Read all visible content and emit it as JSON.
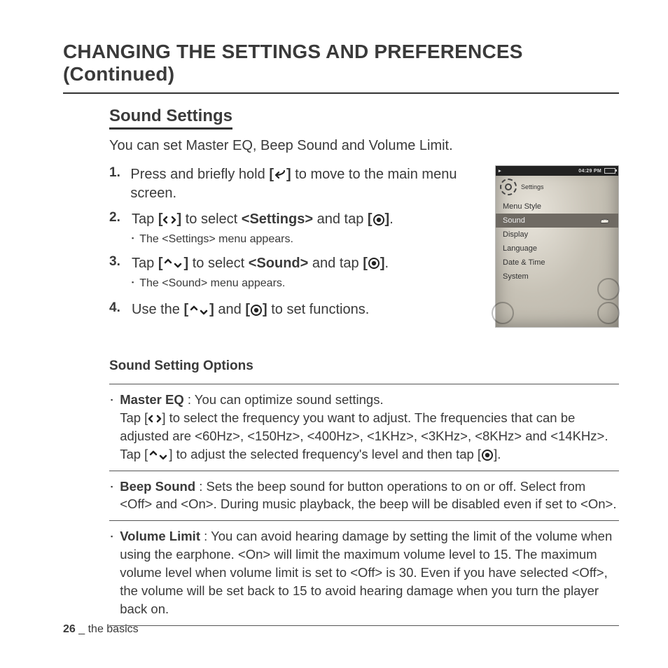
{
  "chapter_title": "CHANGING THE SETTINGS AND PREFERENCES (Continued)",
  "section_title": "Sound Settings",
  "intro": "You can set Master EQ, Beep Sound and Volume Limit.",
  "steps": [
    {
      "num": "1.",
      "pre": "Press and briefly hold ",
      "bracket_open": "[",
      "bracket_close": "]",
      "post": " to move to the main menu screen.",
      "sub": null
    },
    {
      "num": "2.",
      "pre": "Tap ",
      "mid1": " to select ",
      "bold1": "<Settings>",
      "mid2": " and tap ",
      "post": ".",
      "sub": "The <Settings> menu appears."
    },
    {
      "num": "3.",
      "pre": "Tap ",
      "mid1": " to select ",
      "bold1": "<Sound>",
      "mid2": " and tap ",
      "post": ".",
      "sub": "The <Sound> menu appears."
    },
    {
      "num": "4.",
      "pre": "Use the ",
      "mid2": " and ",
      "post": " to set functions.",
      "sub": null
    }
  ],
  "device": {
    "status_time": "04:29 PM",
    "header_label": "Settings",
    "menu": [
      "Menu Style",
      "Sound",
      "Display",
      "Language",
      "Date & Time",
      "System"
    ],
    "selected_index": 1
  },
  "options_heading": "Sound Setting Options",
  "options": [
    {
      "name": "Master EQ",
      "desc": " : You can optimize sound settings.",
      "detail_pre": "Tap [",
      "detail_mid": "] to select the frequency you want to adjust. The frequencies that can be adjusted are <60Hz>, <150Hz>, <400Hz>, <1KHz>, <3KHz>, <8KHz> and <14KHz>. Tap [",
      "detail_post": "] to adjust the selected frequency's level and then tap [",
      "detail_end": "]."
    },
    {
      "name": "Beep Sound",
      "text": " : Sets the beep sound for button operations to on or off. Select from <Off> and <On>. During music playback, the beep will be disabled even if set to <On>."
    },
    {
      "name": "Volume Limit",
      "text": " : You can avoid hearing damage by setting the limit of the volume when using the earphone. <On> will limit the maximum volume level to 15. The maximum volume level when volume limit is set to <Off> is 30. Even if you have selected <Off>, the volume will be set back to 15 to avoid hearing damage when you turn the player back on."
    }
  ],
  "footer": {
    "page": "26",
    "sep": " _ ",
    "section": "the basics"
  }
}
